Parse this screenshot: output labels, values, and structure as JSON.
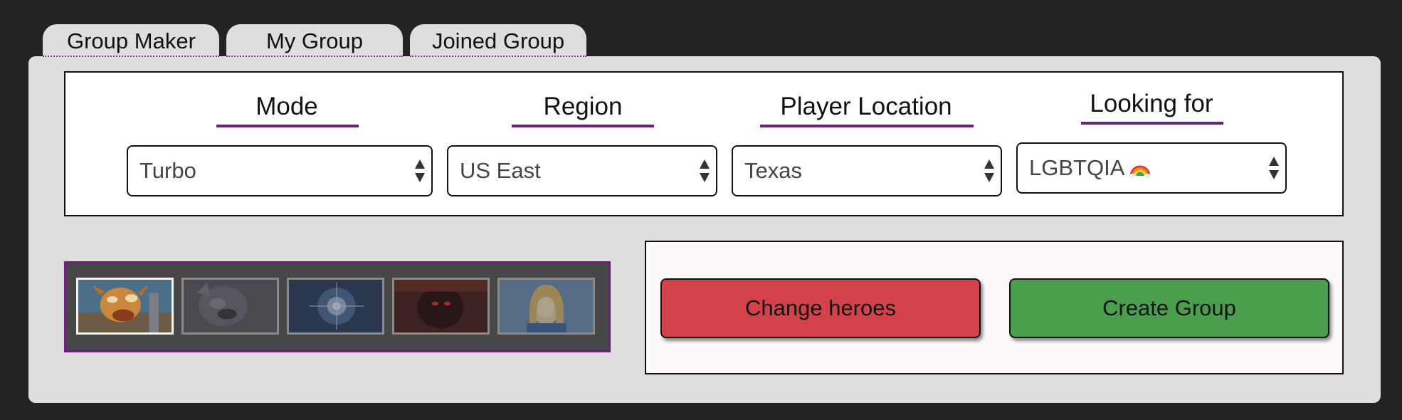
{
  "tabs": [
    {
      "label": "Group Maker"
    },
    {
      "label": "My Group"
    },
    {
      "label": "Joined Group"
    }
  ],
  "filters": [
    {
      "label": "Mode",
      "value": "Turbo"
    },
    {
      "label": "Region",
      "value": "US East"
    },
    {
      "label": "Player Location",
      "value": "Texas"
    },
    {
      "label": "Looking for",
      "value": "LGBTQIA",
      "icon": "rainbow-icon"
    }
  ],
  "heroes": [
    {
      "name": "hero-portrait-1",
      "selected": true
    },
    {
      "name": "hero-portrait-2",
      "selected": false
    },
    {
      "name": "hero-portrait-3",
      "selected": false
    },
    {
      "name": "hero-portrait-4",
      "selected": false
    },
    {
      "name": "hero-portrait-5",
      "selected": false
    }
  ],
  "actions": {
    "change_heroes_label": "Change heroes",
    "create_group_label": "Create Group"
  },
  "colors": {
    "accent": "#6b1e7a",
    "change_heroes": "#d3424a",
    "create_group": "#4a9e4e",
    "panel": "#dedede",
    "background": "#232323"
  }
}
